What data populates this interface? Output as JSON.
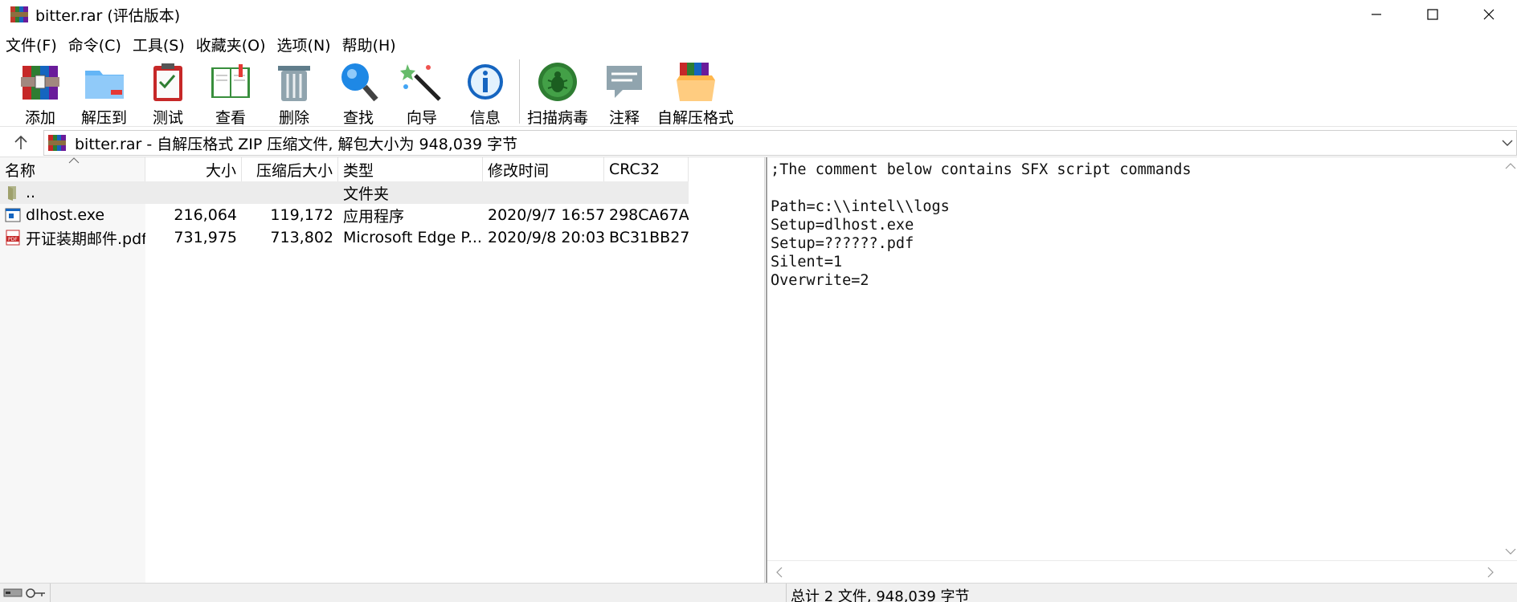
{
  "window": {
    "title": "bitter.rar (评估版本)",
    "controls": [
      "minimize",
      "maximize",
      "close"
    ]
  },
  "menu": [
    {
      "label": "文件(F)"
    },
    {
      "label": "命令(C)"
    },
    {
      "label": "工具(S)"
    },
    {
      "label": "收藏夹(O)"
    },
    {
      "label": "选项(N)"
    },
    {
      "label": "帮助(H)"
    }
  ],
  "toolbar": [
    {
      "label": "添加",
      "icon": "add-archive-icon"
    },
    {
      "label": "解压到",
      "icon": "extract-folder-icon"
    },
    {
      "label": "测试",
      "icon": "test-clipboard-icon"
    },
    {
      "label": "查看",
      "icon": "view-book-icon"
    },
    {
      "label": "删除",
      "icon": "trash-icon"
    },
    {
      "label": "查找",
      "icon": "magnifier-icon"
    },
    {
      "label": "向导",
      "icon": "wizard-wand-icon"
    },
    {
      "label": "信息",
      "icon": "info-icon"
    },
    {
      "label": "扫描病毒",
      "icon": "virus-scan-icon"
    },
    {
      "label": "注释",
      "icon": "comment-bubble-icon"
    },
    {
      "label": "自解压格式",
      "icon": "sfx-box-icon"
    }
  ],
  "pathbar": {
    "text": "bitter.rar - 自解压格式 ZIP 压缩文件, 解包大小为 948,039 字节"
  },
  "columns": {
    "name": "名称",
    "size": "大小",
    "packed": "压缩后大小",
    "type": "类型",
    "modified": "修改时间",
    "crc": "CRC32"
  },
  "rows": [
    {
      "name": "..",
      "size": "",
      "packed": "",
      "type": "文件夹",
      "modified": "",
      "crc": "",
      "icon": "parent-folder-icon"
    },
    {
      "name": "dlhost.exe",
      "size": "216,064",
      "packed": "119,172",
      "type": "应用程序",
      "modified": "2020/9/7 16:57",
      "crc": "298CA67A",
      "icon": "exe-file-icon"
    },
    {
      "name": "开证装期邮件.pdf",
      "size": "731,975",
      "packed": "713,802",
      "type": "Microsoft Edge P...",
      "modified": "2020/9/8 20:03",
      "crc": "BC31BB27",
      "icon": "pdf-file-icon"
    }
  ],
  "comment": {
    "text": ";The comment below contains SFX script commands\n\nPath=c:\\\\intel\\\\logs\nSetup=dlhost.exe\nSetup=??????.pdf\nSilent=1\nOverwrite=2"
  },
  "status": {
    "summary": "总计 2 文件, 948,039 字节"
  }
}
